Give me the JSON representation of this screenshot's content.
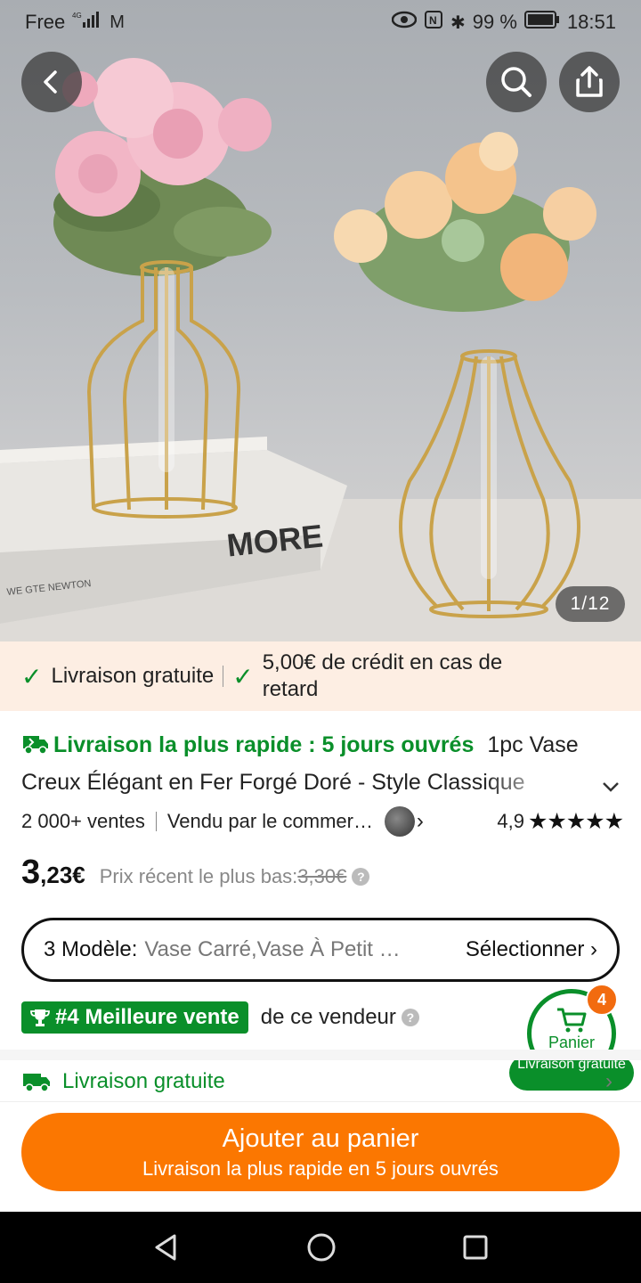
{
  "status_bar": {
    "carrier": "Free",
    "network": "4G",
    "battery": "99 %",
    "time": "18:51"
  },
  "gallery": {
    "counter": "1/12",
    "scene_text": "MORE",
    "scene_text_small": "WE GTE NEWTON"
  },
  "guarantee": {
    "item1": "Livraison gratuite",
    "item2": "5,00€ de crédit en cas de retard"
  },
  "product": {
    "fast_shipping": "Livraison la plus rapide : 5 jours ouvrés",
    "title_part1": "1pc Vase",
    "title_part2": "Creux Élégant en Fer Forgé Doré - Style Classique",
    "sales": "2 000+ ventes",
    "seller": "Vendu par le commerçant",
    "rating": "4,9",
    "stars": "★★★★★"
  },
  "price": {
    "integer": "3",
    "decimal": ",23€",
    "note": "Prix récent le plus bas:",
    "old": "3,30€"
  },
  "variant": {
    "label": "3 Modèle:",
    "value": "Vase Carré,Vase À Petit Col,Vase À Grand Ventre",
    "action": "Sélectionner"
  },
  "bestseller": {
    "badge": "#4 Meilleure vente",
    "text": "de ce vendeur"
  },
  "cart": {
    "count": "4",
    "label": "Panier",
    "shipping": "Livraison gratuite"
  },
  "shipping_row": {
    "label": "Livraison gratuite"
  },
  "cta": {
    "main": "Ajouter au panier",
    "sub": "Livraison la plus rapide en 5 jours ouvrés"
  },
  "colors": {
    "accent_orange": "#fb7701",
    "green": "#0a8f2a",
    "strip_bg": "#fdeee3"
  }
}
